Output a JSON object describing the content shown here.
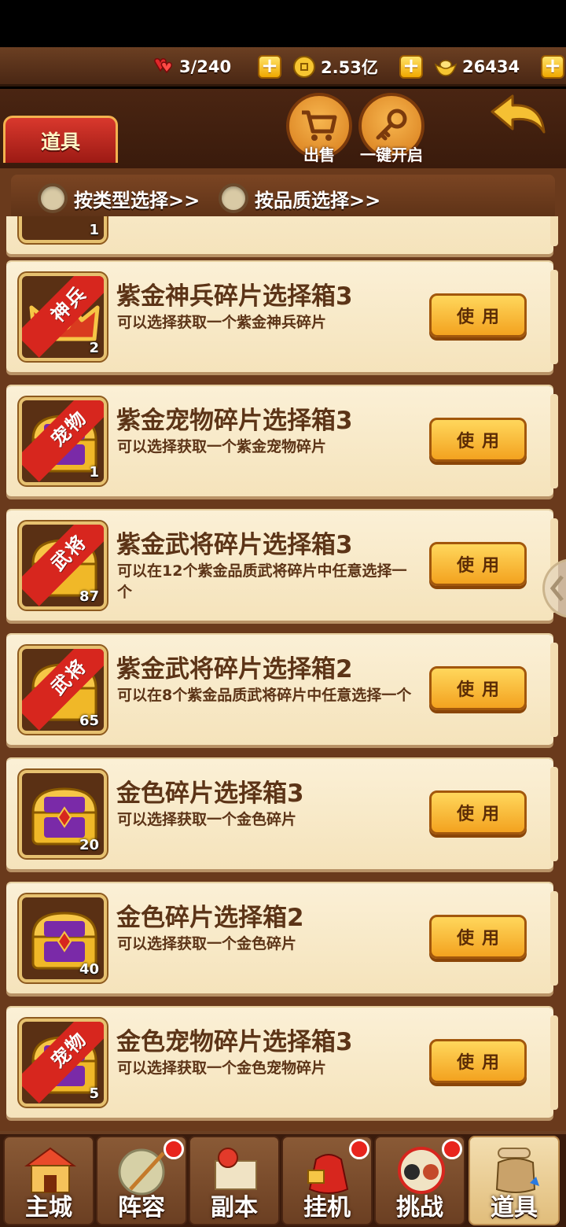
{
  "top_bar": {
    "stamina": "3/240",
    "gold": "2.53亿",
    "ingots": "26434"
  },
  "header": {
    "tab_title": "道具",
    "sell_label": "出售",
    "open_all_label": "一键开启"
  },
  "filters": {
    "by_type": "按类型选择>>",
    "by_quality": "按品质选择>>"
  },
  "partial_item": {
    "count": "1"
  },
  "items": [
    {
      "name": "紫金神兵碎片选择箱3",
      "desc": "可以选择获取一个紫金神兵碎片",
      "count": "2",
      "ribbon": "神兵",
      "use": "使用"
    },
    {
      "name": "紫金宠物碎片选择箱3",
      "desc": "可以选择获取一个紫金宠物碎片",
      "count": "1",
      "ribbon": "宠物",
      "use": "使用"
    },
    {
      "name": "紫金武将碎片选择箱3",
      "desc": "可以在12个紫金品质武将碎片中任意选择一个",
      "count": "87",
      "ribbon": "武将",
      "use": "使用"
    },
    {
      "name": "紫金武将碎片选择箱2",
      "desc": "可以在8个紫金品质武将碎片中任意选择一个",
      "count": "65",
      "ribbon": "武将",
      "use": "使用"
    },
    {
      "name": "金色碎片选择箱3",
      "desc": "可以选择获取一个金色碎片",
      "count": "20",
      "ribbon": "",
      "use": "使用"
    },
    {
      "name": "金色碎片选择箱2",
      "desc": "可以选择获取一个金色碎片",
      "count": "40",
      "ribbon": "",
      "use": "使用"
    },
    {
      "name": "金色宠物碎片选择箱3",
      "desc": "可以选择获取一个金色宠物碎片",
      "count": "5",
      "ribbon": "宠物",
      "use": "使用"
    }
  ],
  "nav": {
    "main_city": "主城",
    "lineup": "阵容",
    "dungeon": "副本",
    "idle": "挂机",
    "challenge": "挑战",
    "items": "道具"
  },
  "colors": {
    "panel_bg": "#6a3a1c",
    "card_bg": "#fbf0d6",
    "button": "#f3a21f",
    "ribbon": "#d7261e"
  }
}
